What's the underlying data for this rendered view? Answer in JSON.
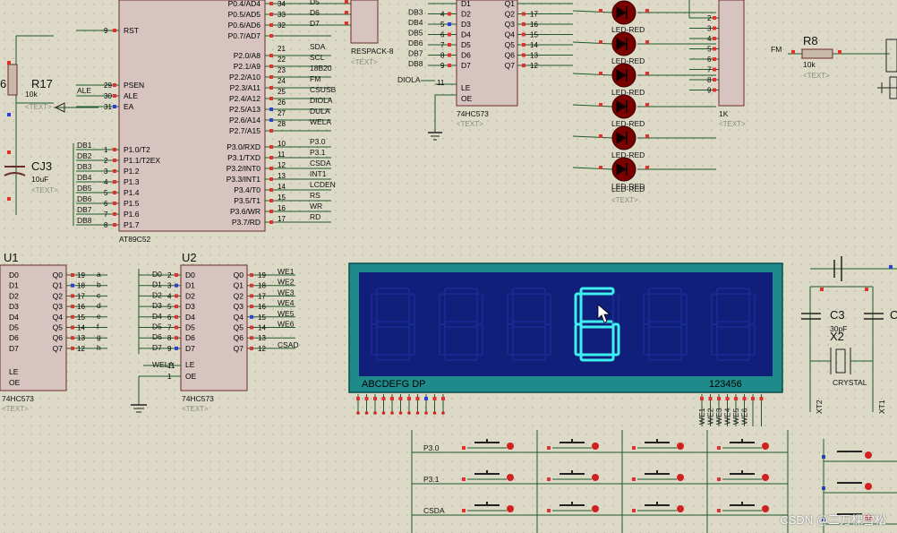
{
  "mcu": {
    "name": "AT89C52",
    "left_pins": [
      "RST",
      "PSEN",
      "ALE",
      "EA",
      "P1.0/T2",
      "P1.1/T2EX",
      "P1.2",
      "P1.3",
      "P1.4",
      "P1.5",
      "P1.6",
      "P1.7"
    ],
    "right_pins": [
      "P0.4/AD4",
      "P0.5/AD5",
      "P0.6/AD6",
      "P0.7/AD7",
      "P2.0/A8",
      "P2.1/A9",
      "P2.2/A10",
      "P2.3/A11",
      "P2.4/A12",
      "P2.5/A13",
      "P2.6/A14",
      "P2.7/A15",
      "P3.0/RXD",
      "P3.1/TXD",
      "P3.2/INT0",
      "P3.3/INT1",
      "P3.4/T0",
      "P3.5/T1",
      "P3.6/WR",
      "P3.7/RD"
    ],
    "left_nums": [
      "9",
      "29",
      "30",
      "31",
      "1",
      "2",
      "3",
      "4",
      "5",
      "6",
      "7",
      "8"
    ],
    "right_nums": [
      "34",
      "33",
      "32",
      "21",
      "22",
      "23",
      "24",
      "25",
      "26",
      "27",
      "28",
      "10",
      "11",
      "12",
      "13",
      "14",
      "15",
      "16",
      "17"
    ],
    "right_nets": [
      "D5",
      "D6",
      "D7",
      "SDA",
      "SCL",
      "18B20",
      "FM",
      "CSUSB",
      "DIOLA",
      "DULA",
      "WELA",
      "P3.0",
      "P3.1",
      "CSDA",
      "INT1",
      "LCDEN",
      "RS",
      "WR",
      "RD"
    ],
    "left_nets": [
      "ALE",
      "DB1",
      "DB2",
      "DB3",
      "DB4",
      "DB5",
      "DB6",
      "DB7",
      "DB8"
    ]
  },
  "respack": {
    "name": "RESPACK-8",
    "text": "<TEXT>"
  },
  "latch_top": {
    "name": "74HC573",
    "inputs": [
      "D1",
      "D2",
      "D3",
      "D4",
      "D5",
      "D6",
      "D7"
    ],
    "in_nets": [
      "DB3",
      "DB4",
      "DB5",
      "DB6",
      "DB7",
      "DB8"
    ],
    "in_nums": [
      "4",
      "5",
      "6",
      "7",
      "8",
      "9"
    ],
    "outputs": [
      "Q1",
      "Q2",
      "Q3",
      "Q4",
      "Q5",
      "Q6",
      "Q7"
    ],
    "out_nums": [
      "17",
      "16",
      "15",
      "14",
      "13",
      "12"
    ],
    "le": "LE",
    "oe": "OE",
    "le_net": "DIOLA",
    "le_num": "11",
    "text": "<TEXT>"
  },
  "leds": {
    "label": "LED-RED",
    "text": "<TEXT>",
    "count": 6
  },
  "res_1k": {
    "name": "1K",
    "nums": [
      "2",
      "3",
      "4",
      "5",
      "6",
      "7",
      "8",
      "9"
    ],
    "text": "<TEXT>"
  },
  "r8": {
    "ref": "R8",
    "value": "10k",
    "net": "FM",
    "text": "<TEXT>"
  },
  "r17": {
    "ref": "R17",
    "value": "10k",
    "text": "<TEXT>",
    "partial": "6"
  },
  "cj3": {
    "ref": "CJ3",
    "value": "10uF",
    "text": "<TEXT>"
  },
  "u1": {
    "ref": "U1",
    "name": "74HC573",
    "inputs": [
      "D0",
      "D1",
      "D2",
      "D3",
      "D4",
      "D5",
      "D6",
      "D7"
    ],
    "outputs": [
      "Q0",
      "Q1",
      "Q2",
      "Q3",
      "Q4",
      "Q5",
      "Q6",
      "Q7"
    ],
    "out_nums": [
      "19",
      "18",
      "17",
      "16",
      "15",
      "14",
      "13",
      "12"
    ],
    "out_nets": [
      "a",
      "b",
      "c",
      "d",
      "e",
      "f",
      "g",
      "h"
    ],
    "le": "LE",
    "oe": "OE",
    "text": "<TEXT>"
  },
  "u2": {
    "ref": "U2",
    "name": "74HC573",
    "inputs": [
      "D0",
      "D1",
      "D2",
      "D3",
      "D4",
      "D5",
      "D6",
      "D7"
    ],
    "in_nets": [
      "D0",
      "D1",
      "D2",
      "D3",
      "D4",
      "D5",
      "D6",
      "D7"
    ],
    "in_nums": [
      "2",
      "3",
      "4",
      "5",
      "6",
      "7",
      "8",
      "9"
    ],
    "outputs": [
      "Q0",
      "Q1",
      "Q2",
      "Q3",
      "Q4",
      "Q5",
      "Q6",
      "Q7"
    ],
    "out_nums": [
      "19",
      "18",
      "17",
      "16",
      "15",
      "14",
      "13",
      "12"
    ],
    "out_nets": [
      "WE1",
      "WE2",
      "WE3",
      "WE4",
      "WE5",
      "WE6",
      "",
      "CSAD"
    ],
    "le": "LE",
    "oe": "OE",
    "le_net": "WELA",
    "le_num": "11",
    "oe_num": "1",
    "text": "<TEXT>"
  },
  "display": {
    "digit_shown": "6",
    "segment_label": "ABCDEFG DP",
    "digit_label": "123456",
    "bottom_nets": [
      "WE1",
      "WE2",
      "WE3",
      "WE4",
      "WE5",
      "WE6"
    ],
    "colors": {
      "frame": "#1f8a8a",
      "panel": "#0f1f7a",
      "lit": "#3ef0f0",
      "unlit": "#1a2d95"
    }
  },
  "crystal": {
    "c3": "C3",
    "c3_value": "30pF",
    "x2": "X2",
    "x2_label": "CRYSTAL",
    "xt1": "XT1",
    "xt2": "XT2",
    "c_partial": "C"
  },
  "keypad": {
    "row_labels": [
      "P3.0",
      "P3.1",
      "CSDA"
    ]
  },
  "watermark": "CSDN @三万棵雪松"
}
